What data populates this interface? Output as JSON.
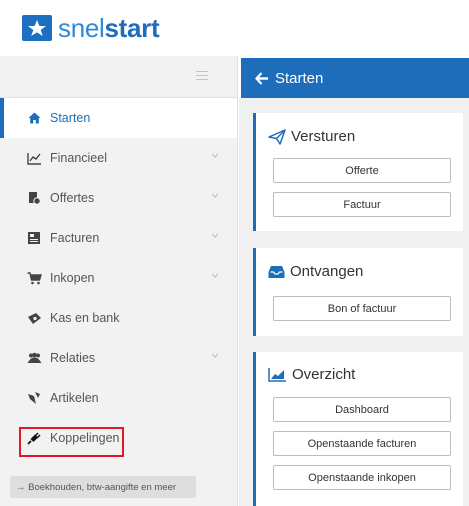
{
  "brand": {
    "name_part1": "snel",
    "name_part2": "start"
  },
  "sidebar": {
    "items": [
      {
        "label": "Starten",
        "icon": "home-icon",
        "active": true,
        "expandable": false
      },
      {
        "label": "Financieel",
        "icon": "chart-line-icon",
        "active": false,
        "expandable": true
      },
      {
        "label": "Offertes",
        "icon": "quote-icon",
        "active": false,
        "expandable": true
      },
      {
        "label": "Facturen",
        "icon": "invoice-icon",
        "active": false,
        "expandable": true
      },
      {
        "label": "Inkopen",
        "icon": "cart-icon",
        "active": false,
        "expandable": true
      },
      {
        "label": "Kas en bank",
        "icon": "money-icon",
        "active": false,
        "expandable": false
      },
      {
        "label": "Relaties",
        "icon": "users-icon",
        "active": false,
        "expandable": true
      },
      {
        "label": "Artikelen",
        "icon": "articles-icon",
        "active": false,
        "expandable": false
      },
      {
        "label": "Koppelingen",
        "icon": "plug-icon",
        "active": false,
        "expandable": false,
        "highlighted": true
      }
    ],
    "more_button": "→ Boekhouden, btw-aangifte en meer"
  },
  "main": {
    "header_title": "Starten",
    "cards": [
      {
        "title": "Versturen",
        "icon": "send-icon",
        "buttons": [
          "Offerte",
          "Factuur"
        ]
      },
      {
        "title": "Ontvangen",
        "icon": "inbox-icon",
        "buttons": [
          "Bon of factuur"
        ]
      },
      {
        "title": "Overzicht",
        "icon": "area-chart-icon",
        "buttons": [
          "Dashboard",
          "Openstaande facturen",
          "Openstaande inkopen"
        ]
      }
    ]
  },
  "colors": {
    "accent": "#1e6dbb",
    "highlight_border": "#e0182a",
    "sidebar_bg": "#f2f2f2"
  }
}
